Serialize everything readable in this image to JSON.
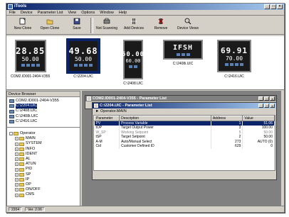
{
  "app": {
    "title": "iTools"
  },
  "menu": [
    "File",
    "Device",
    "Parameter List",
    "View",
    "Options",
    "Window",
    "Help"
  ],
  "toolbar": [
    {
      "label": "New Clone",
      "icon": "new-clone-icon"
    },
    {
      "label": "Open Clone",
      "icon": "open-clone-icon"
    },
    {
      "label": "Save",
      "icon": "save-icon"
    },
    {
      "label": "Not Scanning",
      "icon": "scan-icon"
    },
    {
      "label": "Add Devices",
      "icon": "add-devices-icon"
    },
    {
      "label": "Remove",
      "icon": "remove-icon"
    },
    {
      "label": "Device Views",
      "icon": "device-views-icon"
    }
  ],
  "devices": [
    {
      "line1": "28.85",
      "line2": "50.00",
      "label": "COM2.ID001-2404-V355"
    },
    {
      "line1": "49.68",
      "line2": "50.00",
      "label": "C:\\2204.UIC"
    },
    {
      "line1": "60.00",
      "line2": "60.00",
      "label": "C:\\2408.UIC"
    },
    {
      "line1": "IFSH",
      "line2": "",
      "label": "C:\\2408i.UIC"
    },
    {
      "line1": "69.91",
      "line2": "70.00",
      "label": "C:\\2416.UIC"
    }
  ],
  "browser": {
    "title": "Device Browser",
    "devices": [
      "COM2.ID001-2404-V355",
      "C:\\2204.UIC",
      "C:\\2408.UIC",
      "C:\\2408i.UIC",
      "C:\\2416.UIC"
    ],
    "root": "Operator",
    "folders": [
      "MAIN",
      "SYSTEM",
      "INFO",
      "IDENT",
      "AL",
      "ATUN",
      "PID",
      "SP",
      "IP",
      "OP",
      "ON/OFF",
      "CMS"
    ]
  },
  "status": [
    "2204",
    "Ver. 2.06"
  ],
  "mdi": {
    "back_title": "COM2.ID001-2404-V355 - Parameter List",
    "front_title": "C:\\2204.UIC - Parameter List",
    "crumb": "Operator.MAIN",
    "columns": [
      "Parameter",
      "Description",
      "Address",
      "Value"
    ],
    "rows": [
      {
        "p": "PV",
        "d": "Process Variable",
        "a": "1",
        "v": "51.06",
        "style": "hl"
      },
      {
        "p": "tOP",
        "d": "Target Output Power",
        "a": "3",
        "v": "100.00",
        "style": ""
      },
      {
        "p": "W_SP",
        "d": "Working Setpoint",
        "a": "5",
        "v": "50.00",
        "style": "grey"
      },
      {
        "p": "tSP",
        "d": "Target Setpoint",
        "a": "2",
        "v": "50.00",
        "style": ""
      },
      {
        "p": "A-M",
        "d": "Auto/Manual Select",
        "a": "273",
        "v": "AUTO (0)",
        "style": ""
      },
      {
        "p": "Cid",
        "d": "Customer Defined ID",
        "a": "629",
        "v": "0",
        "style": ""
      }
    ]
  }
}
